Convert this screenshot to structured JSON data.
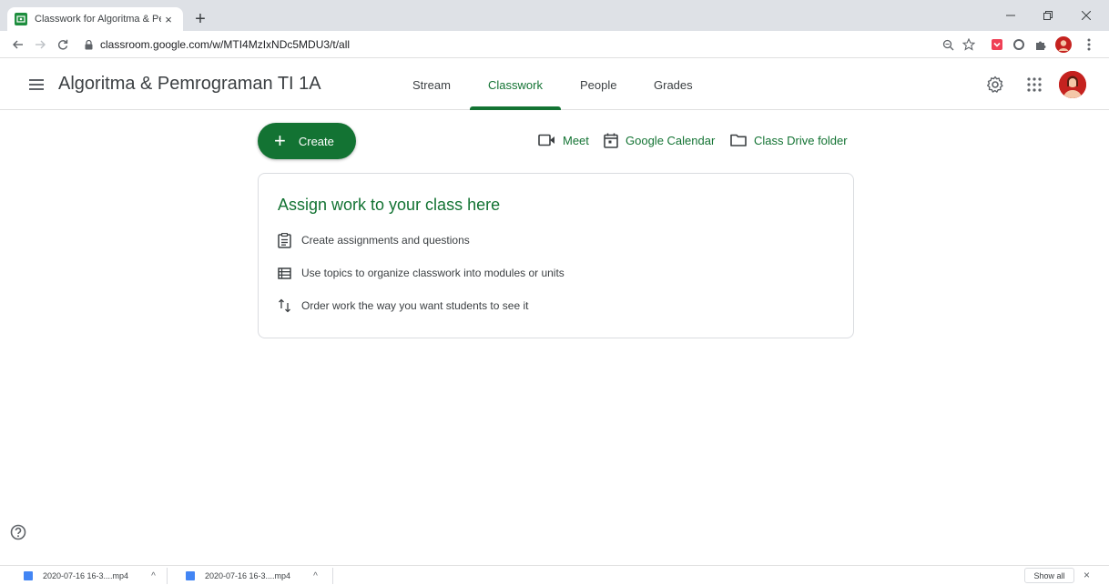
{
  "browser": {
    "tab_title": "Classwork for Algoritma & Pemrog",
    "tab_close": "×",
    "new_tab": "+",
    "url": "classroom.google.com/w/MTI4MzIxNDc5MDU3/t/all"
  },
  "header": {
    "class_title": "Algoritma & Pemrograman TI 1A",
    "tabs": [
      "Stream",
      "Classwork",
      "People",
      "Grades"
    ],
    "active_tab": "Classwork"
  },
  "actions": {
    "create_label": "Create",
    "create_icon": "+",
    "meet_label": "Meet",
    "calendar_label": "Google Calendar",
    "drive_label": "Class Drive folder"
  },
  "card": {
    "title": "Assign work to your class here",
    "rows": [
      {
        "icon": "assignment-icon",
        "text": "Create assignments and questions"
      },
      {
        "icon": "topic-list-icon",
        "text": "Use topics to organize classwork into modules or units"
      },
      {
        "icon": "reorder-icon",
        "text": "Order work the way you want students to see it"
      }
    ]
  },
  "downloads": {
    "items": [
      "2020-07-16 16-3....mp4",
      "2020-07-16 16-3....mp4"
    ],
    "caret": "^",
    "show_all": "Show all",
    "close": "×"
  },
  "colors": {
    "accent": "#137333",
    "tab_strip": "#dee1e6",
    "card_border": "#dadce0"
  }
}
